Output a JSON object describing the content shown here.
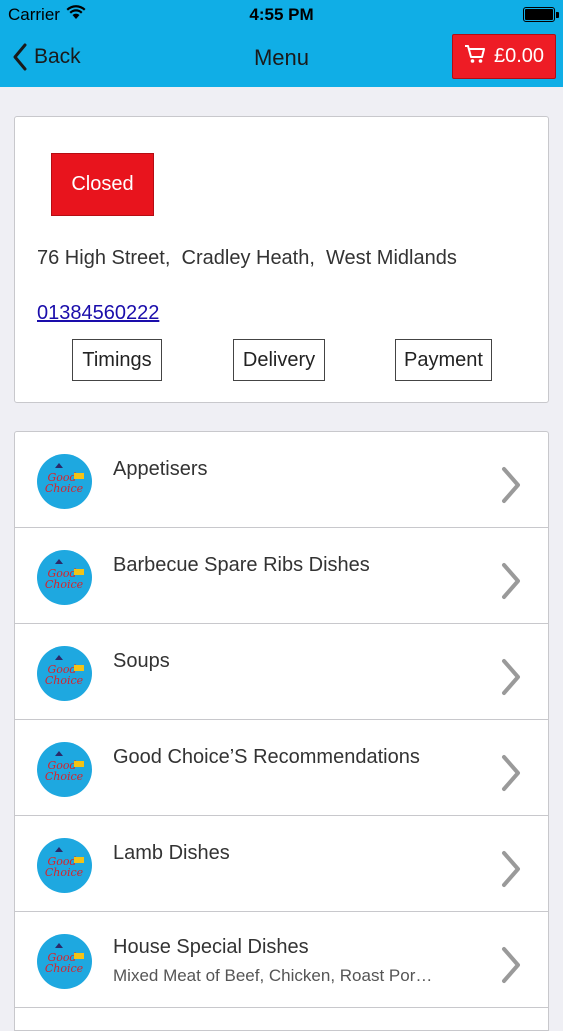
{
  "status_bar": {
    "carrier": "Carrier",
    "time": "4:55 PM"
  },
  "nav": {
    "back_label": "Back",
    "title": "Menu",
    "cart_total": "£0.00"
  },
  "restaurant": {
    "status": "Closed",
    "address": "76 High Street,  Cradley Heath,  West Midlands",
    "phone": "01384560222",
    "buttons": {
      "timings": "Timings",
      "delivery": "Delivery",
      "payment": "Payment"
    }
  },
  "menu": {
    "items": [
      {
        "title": "Appetisers",
        "subtitle": ""
      },
      {
        "title": "Barbecue Spare Ribs Dishes",
        "subtitle": ""
      },
      {
        "title": "Soups",
        "subtitle": ""
      },
      {
        "title": "Good Choice’S Recommendations",
        "subtitle": ""
      },
      {
        "title": "Lamb Dishes",
        "subtitle": ""
      },
      {
        "title": "House Special Dishes",
        "subtitle": "Mixed Meat of Beef, Chicken, Roast Por…"
      }
    ],
    "logo_text": "Good Choice"
  },
  "colors": {
    "header": "#10aee6",
    "accent_red": "#ee1c25",
    "logo_bg": "#1ea8e0"
  }
}
